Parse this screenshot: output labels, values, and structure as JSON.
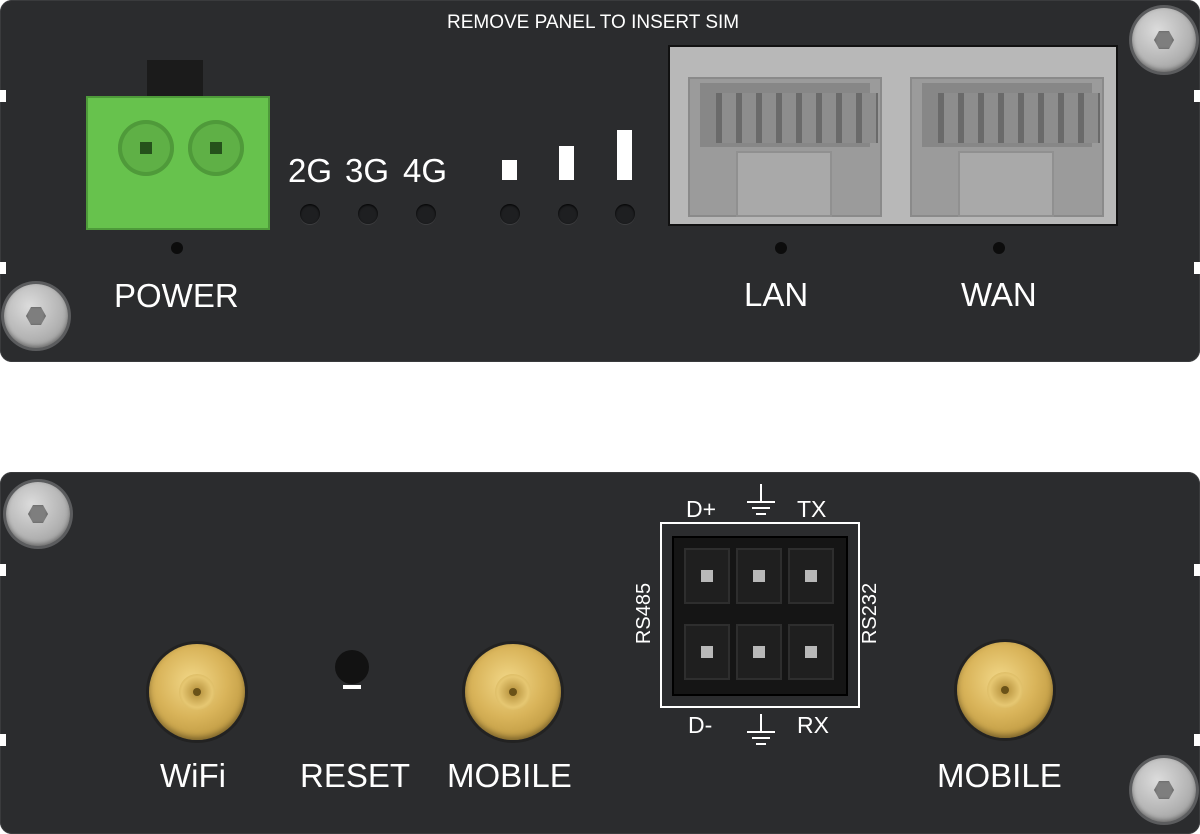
{
  "front_panel": {
    "sim_notice": "REMOVE PANEL TO INSERT SIM",
    "power_label": "POWER",
    "network_labels": [
      "2G",
      "3G",
      "4G"
    ],
    "lan_label": "LAN",
    "wan_label": "WAN",
    "signal_bars": 3,
    "connector_color": "#67c24d"
  },
  "back_panel": {
    "wifi_label": "WiFi",
    "reset_label": "RESET",
    "mobile_label_1": "MOBILE",
    "mobile_label_2": "MOBILE",
    "serial": {
      "d_plus": "D+",
      "d_minus": "D-",
      "tx": "TX",
      "rx": "RX",
      "left_label": "RS485",
      "right_label": "RS232"
    },
    "antenna_color": "#d9b45a"
  }
}
